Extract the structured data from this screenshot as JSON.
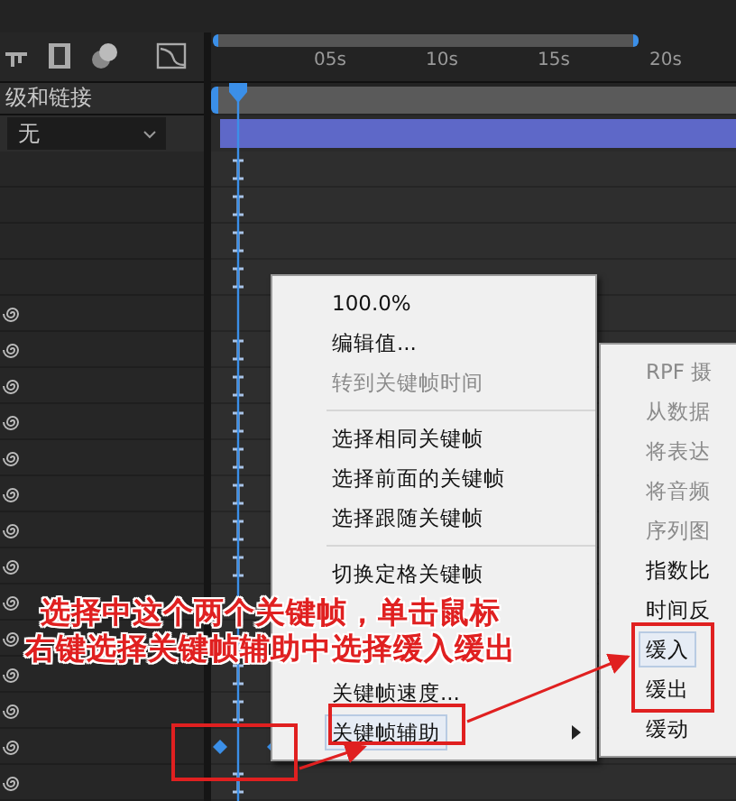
{
  "layer_panel": {
    "header": "级和链接",
    "parent_dropdown": {
      "value": "无"
    }
  },
  "timeline": {
    "ruler_labels": [
      "05s",
      "10s",
      "15s",
      "20s"
    ]
  },
  "context_menu": {
    "items": [
      {
        "kind": "item",
        "label": "100.0%",
        "disabled": false,
        "selected": false
      },
      {
        "kind": "item",
        "label": "编辑值...",
        "disabled": false,
        "selected": false
      },
      {
        "kind": "item",
        "label": "转到关键帧时间",
        "disabled": true,
        "selected": false
      },
      {
        "kind": "separator"
      },
      {
        "kind": "item",
        "label": "选择相同关键帧",
        "disabled": false,
        "selected": false
      },
      {
        "kind": "item",
        "label": "选择前面的关键帧",
        "disabled": false,
        "selected": false
      },
      {
        "kind": "item",
        "label": "选择跟随关键帧",
        "disabled": false,
        "selected": false
      },
      {
        "kind": "separator"
      },
      {
        "kind": "item",
        "label": "切换定格关键帧",
        "disabled": false,
        "selected": false
      },
      {
        "kind": "item",
        "label": "关键帧速度...",
        "disabled": false,
        "selected": false
      },
      {
        "kind": "submenu",
        "label": "关键帧辅助",
        "disabled": false,
        "selected": true
      }
    ]
  },
  "submenu": {
    "items": [
      {
        "label": "RPF 摄",
        "disabled": true,
        "selected": false
      },
      {
        "label": "从数据",
        "disabled": true,
        "selected": false
      },
      {
        "label": "将表达",
        "disabled": true,
        "selected": false
      },
      {
        "label": "将音频",
        "disabled": true,
        "selected": false
      },
      {
        "label": "序列图",
        "disabled": true,
        "selected": false
      },
      {
        "label": "指数比",
        "disabled": false,
        "selected": false
      },
      {
        "label": "时间反",
        "disabled": false,
        "selected": false
      },
      {
        "label": "缓入",
        "disabled": false,
        "selected": true
      },
      {
        "label": "缓出",
        "disabled": false,
        "selected": false
      },
      {
        "label": "缓动",
        "disabled": false,
        "selected": false
      }
    ]
  },
  "annotation": {
    "lines": [
      "选择中这个两个关键帧，单击鼠标",
      "右键选择关键帧辅助中选择缓入缓出"
    ]
  }
}
